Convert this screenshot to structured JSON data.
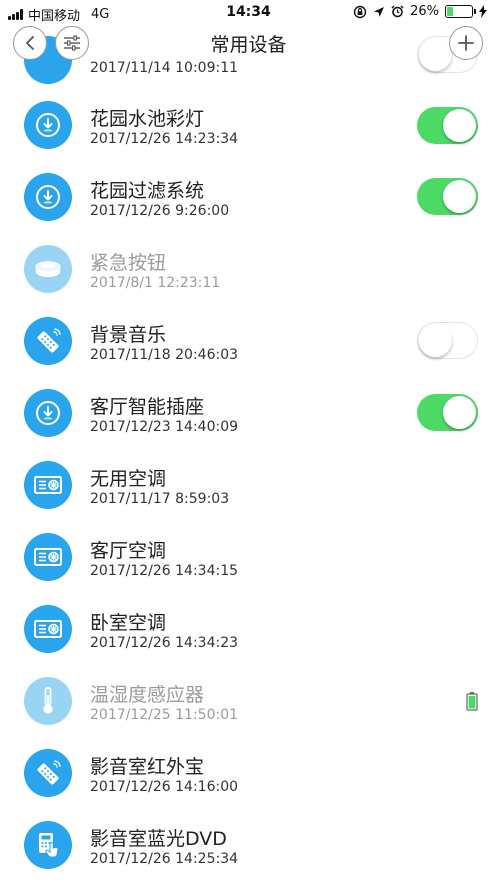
{
  "status_bar": {
    "carrier": "中国移动",
    "network": "4G",
    "time": "14:34",
    "battery_percent": "26%",
    "battery_level": 0.26
  },
  "nav": {
    "title": "常用设备"
  },
  "colors": {
    "accent": "#2aa4ec",
    "accent_disabled": "#9ad4f5",
    "toggle_on": "#4cd964"
  },
  "devices": [
    {
      "name": "",
      "time": "2017/11/14 10:09:11",
      "icon": "socket-icon",
      "toggle": "off",
      "enabled": true
    },
    {
      "name": "花园水池彩灯",
      "time": "2017/12/26 14:23:34",
      "icon": "socket-icon",
      "toggle": "on",
      "enabled": true
    },
    {
      "name": "花园过滤系统",
      "time": "2017/12/26 9:26:00",
      "icon": "socket-icon",
      "toggle": "on",
      "enabled": true
    },
    {
      "name": "紧急按钮",
      "time": "2017/8/1 12:23:11",
      "icon": "emergency-button-icon",
      "toggle": "none",
      "enabled": false
    },
    {
      "name": "背景音乐",
      "time": "2017/11/18 20:46:03",
      "icon": "remote-control-icon",
      "toggle": "off",
      "enabled": true
    },
    {
      "name": "客厅智能插座",
      "time": "2017/12/23 14:40:09",
      "icon": "socket-icon",
      "toggle": "on",
      "enabled": true
    },
    {
      "name": "无用空调",
      "time": "2017/11/17 8:59:03",
      "icon": "air-conditioner-icon",
      "toggle": "none",
      "enabled": true
    },
    {
      "name": "客厅空调",
      "time": "2017/12/26 14:34:15",
      "icon": "air-conditioner-icon",
      "toggle": "none",
      "enabled": true
    },
    {
      "name": "卧室空调",
      "time": "2017/12/26 14:34:23",
      "icon": "air-conditioner-icon",
      "toggle": "none",
      "enabled": true
    },
    {
      "name": "温湿度感应器",
      "time": "2017/12/25 11:50:01",
      "icon": "thermometer-icon",
      "toggle": "none",
      "enabled": false,
      "battery": "battery-full-icon"
    },
    {
      "name": "影音室红外宝",
      "time": "2017/12/26 14:16:00",
      "icon": "remote-control-icon",
      "toggle": "none",
      "enabled": true
    },
    {
      "name": "影音室蓝光DVD",
      "time": "2017/12/26 14:25:34",
      "icon": "dvd-remote-icon",
      "toggle": "none",
      "enabled": true
    }
  ]
}
